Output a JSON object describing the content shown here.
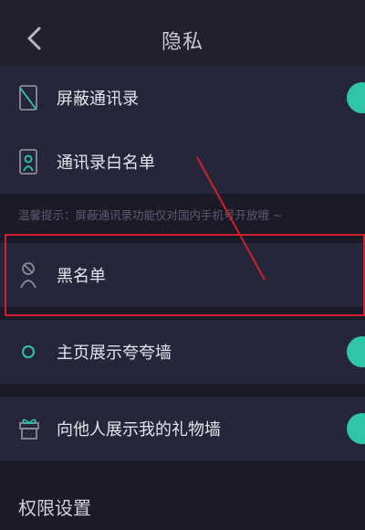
{
  "header": {
    "title": "隐私",
    "back_icon": "chevron-left-icon"
  },
  "rows": [
    {
      "label": "屏蔽通讯录",
      "icon": "contact-block-icon",
      "toggle": "on"
    },
    {
      "label": "通讯录白名单",
      "icon": "contact-whitelist-icon"
    },
    {
      "label": "黑名单",
      "icon": "person-blocked-icon"
    },
    {
      "label": "主页展示夸夸墙",
      "icon": "circle-icon",
      "toggle": "on"
    },
    {
      "label": "向他人展示我的礼物墙",
      "icon": "gift-icon",
      "toggle": "on"
    }
  ],
  "tip": "温馨提示：屏蔽通讯录功能仅对国内手机号开放哦 ~",
  "section_title": "权限设置",
  "colors": {
    "background": "#1a1a28",
    "row_background": "#26263a",
    "accent_teal": "#2fc6a8",
    "annotation_red": "#d11f2d"
  }
}
